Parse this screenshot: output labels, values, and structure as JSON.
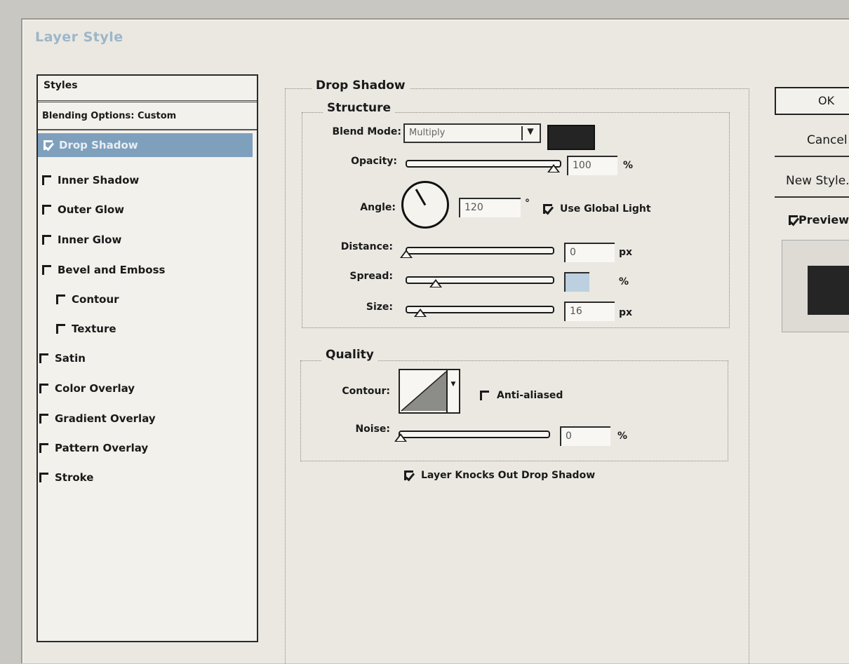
{
  "window": {
    "title": "Layer Style"
  },
  "styles_panel": {
    "header": "Styles",
    "blending": "Blending Options: Custom",
    "items": [
      {
        "label": "Drop Shadow",
        "checked": true,
        "selected": true
      },
      {
        "label": "Inner Shadow",
        "checked": false
      },
      {
        "label": "Outer Glow",
        "checked": false
      },
      {
        "label": "Inner Glow",
        "checked": false
      },
      {
        "label": "Bevel and Emboss",
        "checked": false
      },
      {
        "label": "Contour",
        "checked": false
      },
      {
        "label": "Texture",
        "checked": false
      },
      {
        "label": "Satin",
        "checked": false
      },
      {
        "label": "Color Overlay",
        "checked": false
      },
      {
        "label": "Gradient Overlay",
        "checked": false
      },
      {
        "label": "Pattern Overlay",
        "checked": false
      },
      {
        "label": "Stroke",
        "checked": false
      }
    ]
  },
  "drop_shadow": {
    "title": "Drop Shadow",
    "structure": {
      "title": "Structure",
      "blend_mode_label": "Blend Mode:",
      "blend_mode_value": "Multiply",
      "shadow_color": "#242424",
      "opacity_label": "Opacity:",
      "opacity_value": "100",
      "opacity_unit": "%",
      "angle_label": "Angle:",
      "angle_value": "120",
      "angle_unit": "°",
      "use_global_light": "Use Global Light",
      "distance_label": "Distance:",
      "distance_value": "0",
      "distance_unit": "px",
      "spread_label": "Spread:",
      "spread_value": "",
      "spread_unit": "%",
      "size_label": "Size:",
      "size_value": "16",
      "size_unit": "px"
    },
    "quality": {
      "title": "Quality",
      "contour_label": "Contour:",
      "anti_aliased": "Anti-aliased",
      "noise_label": "Noise:",
      "noise_value": "0",
      "noise_unit": "%"
    },
    "knockout": "Layer Knocks Out Drop Shadow"
  },
  "buttons": {
    "ok": "OK",
    "cancel": "Cancel",
    "new_style": "New Style...",
    "preview": "Preview"
  }
}
